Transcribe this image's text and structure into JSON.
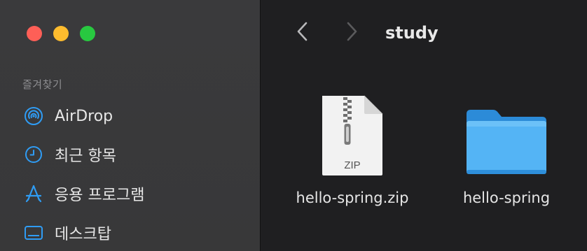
{
  "window": {
    "traffic_lights": [
      "close",
      "minimize",
      "zoom"
    ],
    "colors": {
      "close": "#fe5f57",
      "minimize": "#febc2e",
      "zoom": "#28c840",
      "accent": "#2f9cf4"
    }
  },
  "sidebar": {
    "section_label": "즐겨찾기",
    "items": [
      {
        "label": "AirDrop",
        "icon": "airdrop-icon"
      },
      {
        "label": "최근 항목",
        "icon": "clock-icon"
      },
      {
        "label": "응용 프로그램",
        "icon": "applications-icon"
      },
      {
        "label": "데스크탑",
        "icon": "desktop-icon"
      }
    ]
  },
  "toolbar": {
    "title": "study",
    "back_icon": "chevron-left-icon",
    "forward_icon": "chevron-right-icon"
  },
  "files": [
    {
      "name": "hello-spring.zip",
      "type": "zip",
      "badge": "ZIP",
      "icon": "zip-file-icon"
    },
    {
      "name": "hello-spring",
      "type": "folder",
      "icon": "folder-icon"
    }
  ]
}
